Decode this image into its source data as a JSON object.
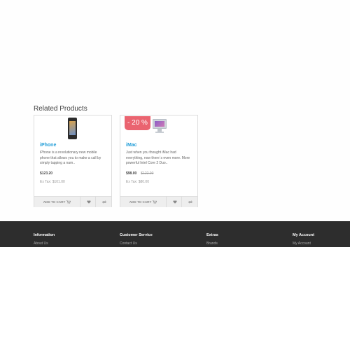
{
  "section": {
    "title": "Related Products"
  },
  "products": [
    {
      "name": "iPhone",
      "description": "iPhone is a revolutionary new mobile phone that allows you to make a call by simply tapping a nam..",
      "price": "$123.20",
      "ex_tax": "Ex Tax: $101.00",
      "image_icon": "iphone-image",
      "buttons": {
        "cart": "ADD TO CART",
        "wishlist_icon": "heart-icon",
        "compare_icon": "compare-icon"
      }
    },
    {
      "name": "iMac",
      "description": "Just when you thought iMac had everything, now there´s even more. More powerful Intel Core 2 Duo..",
      "price": "$98.00",
      "price_old": "$122.00",
      "ex_tax": "Ex Tax: $80.00",
      "badge": "- 20 %",
      "image_icon": "imac-image",
      "buttons": {
        "cart": "ADD TO CART",
        "wishlist_icon": "heart-icon",
        "compare_icon": "compare-icon"
      }
    }
  ],
  "footer": {
    "columns": [
      {
        "title": "Information",
        "link": "About Us"
      },
      {
        "title": "Customer Service",
        "link": "Contact Us"
      },
      {
        "title": "Extras",
        "link": "Brands"
      },
      {
        "title": "My Account",
        "link": "My Account"
      }
    ]
  },
  "colors": {
    "accent": "#239ed8",
    "badge": "#ea6470",
    "footer_bg": "#2d2d2d"
  }
}
